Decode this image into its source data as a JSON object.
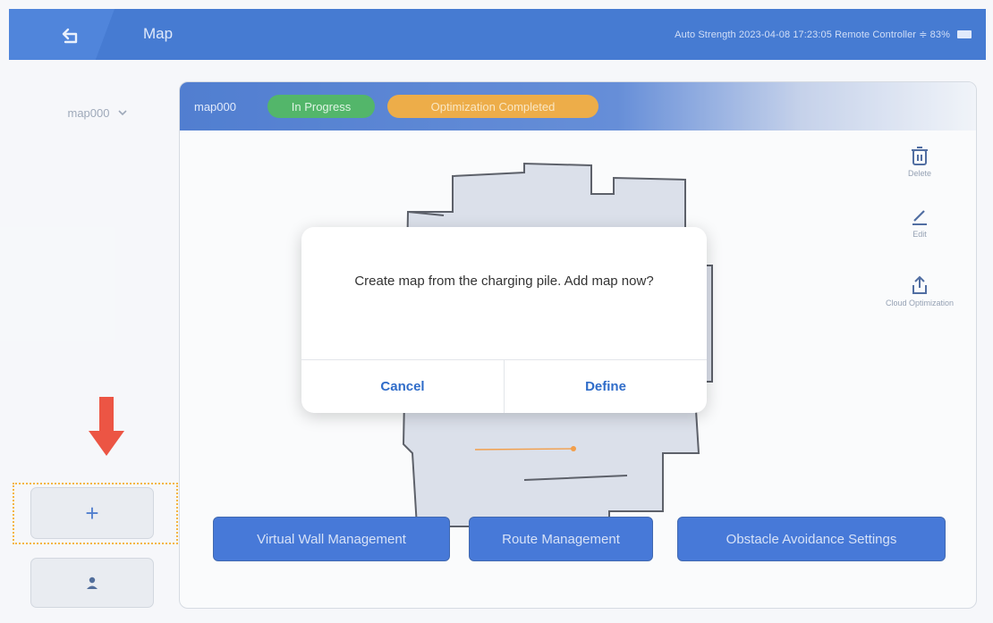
{
  "header": {
    "title": "Map",
    "status_text": "Auto Strength 2023-04-08 17:23:05  Remote Controller  ≑  83%",
    "back_icon": "back-arrow-icon"
  },
  "sidebar": {
    "map_selector": {
      "value": "map000",
      "icon": "chevron-down-icon"
    },
    "add_button": {
      "label": "+",
      "icon": "plus-icon"
    },
    "person_button": {
      "icon": "person-icon"
    }
  },
  "panel": {
    "map_name": "map000",
    "progress_badge": "In Progress",
    "optimization_badge": "Optimization Completed",
    "status_colors": {
      "progress": "#2ea64a",
      "optimization": "#e99b22"
    },
    "tools": [
      {
        "label": "Delete",
        "icon": "trash-icon"
      },
      {
        "label": "Edit",
        "icon": "pencil-icon"
      },
      {
        "label": "Cloud Optimization",
        "icon": "upload-icon"
      }
    ],
    "actions": [
      {
        "label": "Virtual Wall Management"
      },
      {
        "label": "Route Management"
      },
      {
        "label": "Obstacle Avoidance Settings"
      }
    ]
  },
  "dialog": {
    "message": "Create map from the charging pile. Add map now?",
    "cancel_label": "Cancel",
    "define_label": "Define"
  },
  "annotation": {
    "arrow_color": "#e8301c",
    "highlight_color": "#f2a71b"
  }
}
